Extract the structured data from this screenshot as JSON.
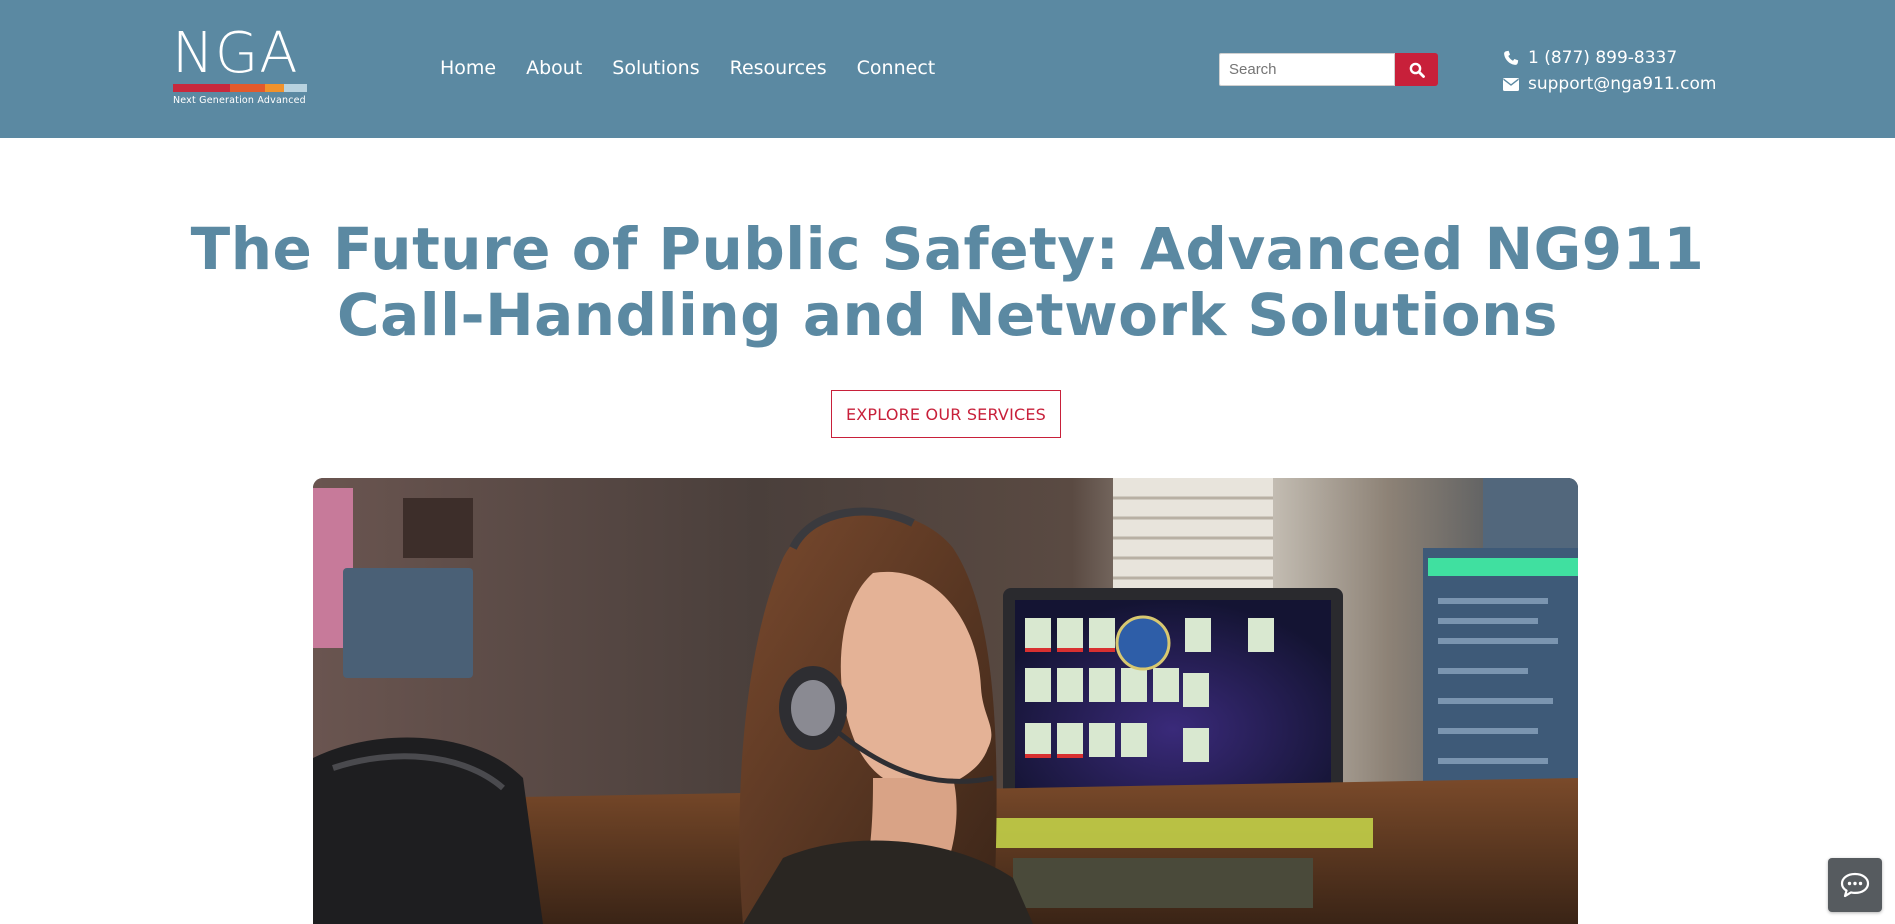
{
  "logo": {
    "text": "NGA",
    "tagline": "Next Generation Advanced",
    "bar_colors": [
      "#c8283c",
      "#e25a2c",
      "#f0922c",
      "#b8d2df"
    ]
  },
  "nav": {
    "items": [
      {
        "label": "Home"
      },
      {
        "label": "About"
      },
      {
        "label": "Solutions"
      },
      {
        "label": "Resources"
      },
      {
        "label": "Connect"
      }
    ]
  },
  "search": {
    "placeholder": "Search",
    "button_icon": "search-icon"
  },
  "contact": {
    "phone": "1 (877) 899-8337",
    "phone_icon": "phone-icon",
    "email": "support@nga911.com",
    "email_icon": "envelope-icon"
  },
  "hero": {
    "title_line1": "The Future of Public Safety: Advanced NG911",
    "title_line2": "Call-Handling and Network Solutions",
    "cta_label": "EXPLORE OUR SERVICES"
  },
  "chat": {
    "icon": "chat-bubble-icon"
  },
  "colors": {
    "header_bg": "#5b89a2",
    "accent_red": "#c8203a",
    "title_blue": "#5b89a2"
  }
}
